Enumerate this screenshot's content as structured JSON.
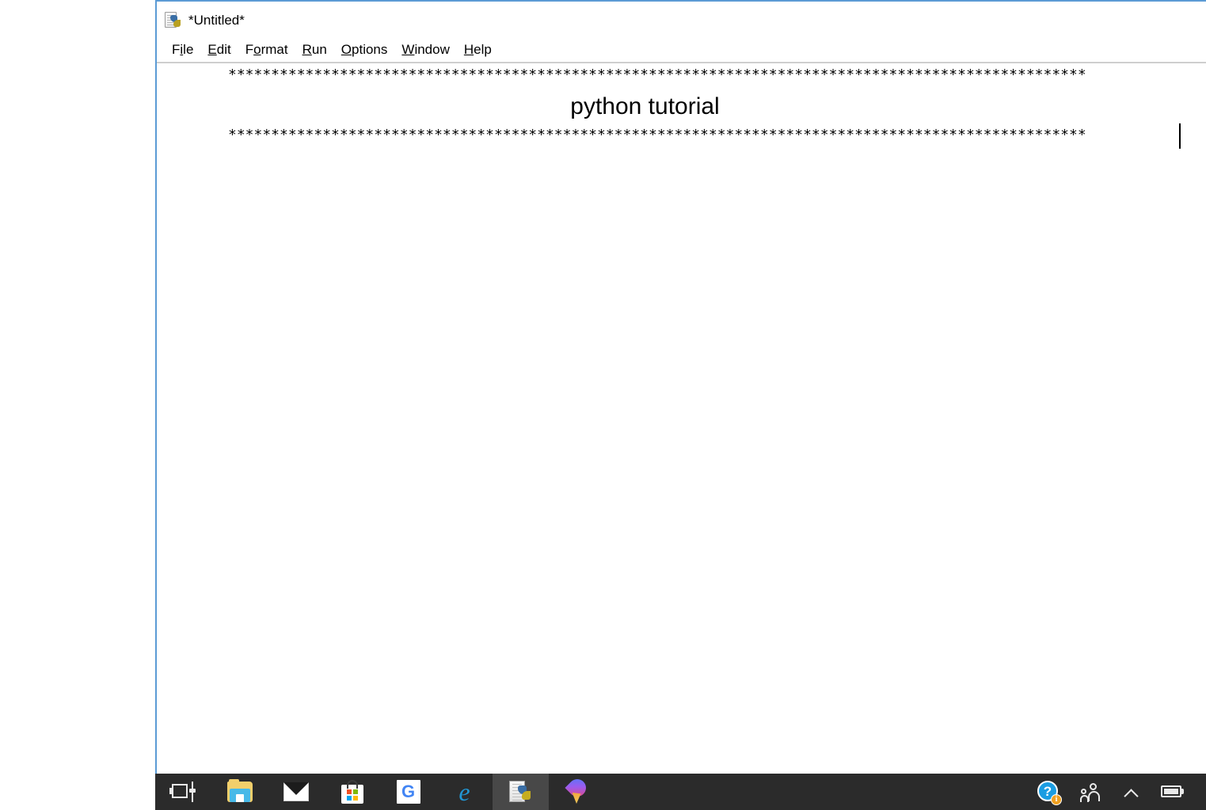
{
  "window": {
    "title": "*Untitled*",
    "icon": "idle-python-document-icon",
    "border_color": "#5b9bd5",
    "background": "#ffffff"
  },
  "menu": {
    "items": [
      {
        "label": "File",
        "pre": "F",
        "mnemonic": "i",
        "post": "le"
      },
      {
        "label": "Edit",
        "pre": "",
        "mnemonic": "E",
        "post": "dit"
      },
      {
        "label": "Format",
        "pre": "F",
        "mnemonic": "o",
        "post": "rmat"
      },
      {
        "label": "Run",
        "pre": "",
        "mnemonic": "R",
        "post": "un"
      },
      {
        "label": "Options",
        "pre": "",
        "mnemonic": "O",
        "post": "ptions"
      },
      {
        "label": "Window",
        "pre": "",
        "mnemonic": "W",
        "post": "indow"
      },
      {
        "label": "Help",
        "pre": "",
        "mnemonic": "H",
        "post": "elp"
      }
    ]
  },
  "editor": {
    "star_line_1": "****************************************************************************************************",
    "star_line_2": "****************************************************************************************************",
    "center_text": "python tutorial",
    "caret_visible": true
  },
  "taskbar": {
    "background": "#2b2b2b",
    "active_button_background": "#484848",
    "buttons": [
      {
        "name": "task-view",
        "label": "Task View"
      },
      {
        "name": "file-explorer",
        "label": "File Explorer"
      },
      {
        "name": "mail",
        "label": "Mail"
      },
      {
        "name": "microsoft-store",
        "label": "Microsoft Store"
      },
      {
        "name": "google-chrome",
        "label": "Google Chrome",
        "glyph": "G"
      },
      {
        "name": "internet-explorer",
        "label": "Internet Explorer",
        "glyph": "e"
      },
      {
        "name": "python-idle",
        "label": "IDLE",
        "active": true
      },
      {
        "name": "paint-3d",
        "label": "Paint 3D"
      }
    ],
    "tray": [
      {
        "name": "get-help",
        "label": "Get Help",
        "glyph": "?",
        "badge": "i"
      },
      {
        "name": "people",
        "label": "People"
      },
      {
        "name": "show-hidden",
        "label": "Show hidden icons"
      },
      {
        "name": "battery",
        "label": "Battery"
      }
    ]
  }
}
